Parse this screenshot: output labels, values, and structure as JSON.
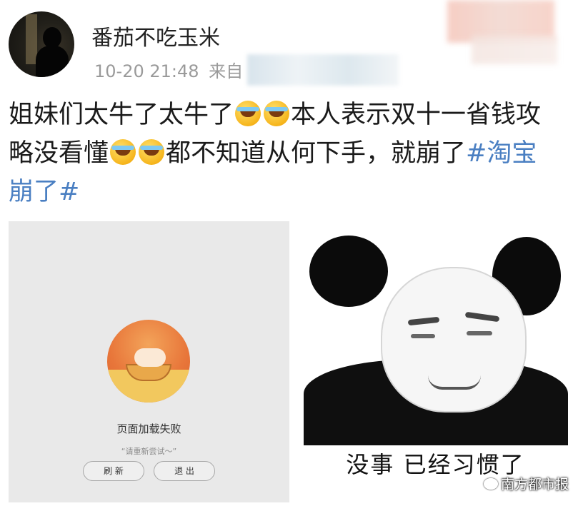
{
  "post": {
    "username": "番茄不吃玉米",
    "timestamp": "10-20 21:48",
    "source_prefix": "来自",
    "content_line1_a": "姐妹们太牛了太牛了",
    "content_line1_b": "本人表示双十一省钱攻",
    "content_line2_a": "略没看懂",
    "content_line2_b": "都不知道从何下手，就崩了",
    "hashtag_line2": "#淘宝",
    "hashtag_line3": "崩了#",
    "emoji_name": "laugh-cry-emoji"
  },
  "image_left": {
    "title": "页面加载失败",
    "subtitle": "“请重新尝试～”",
    "refresh_label": "刷 新",
    "exit_label": "退 出"
  },
  "image_right": {
    "caption": "没事  已经习惯了"
  },
  "watermark": "南方都市报",
  "colors": {
    "hashtag": "#4a7fc2",
    "text": "#1a1a1a",
    "meta": "#9a9a9a"
  }
}
